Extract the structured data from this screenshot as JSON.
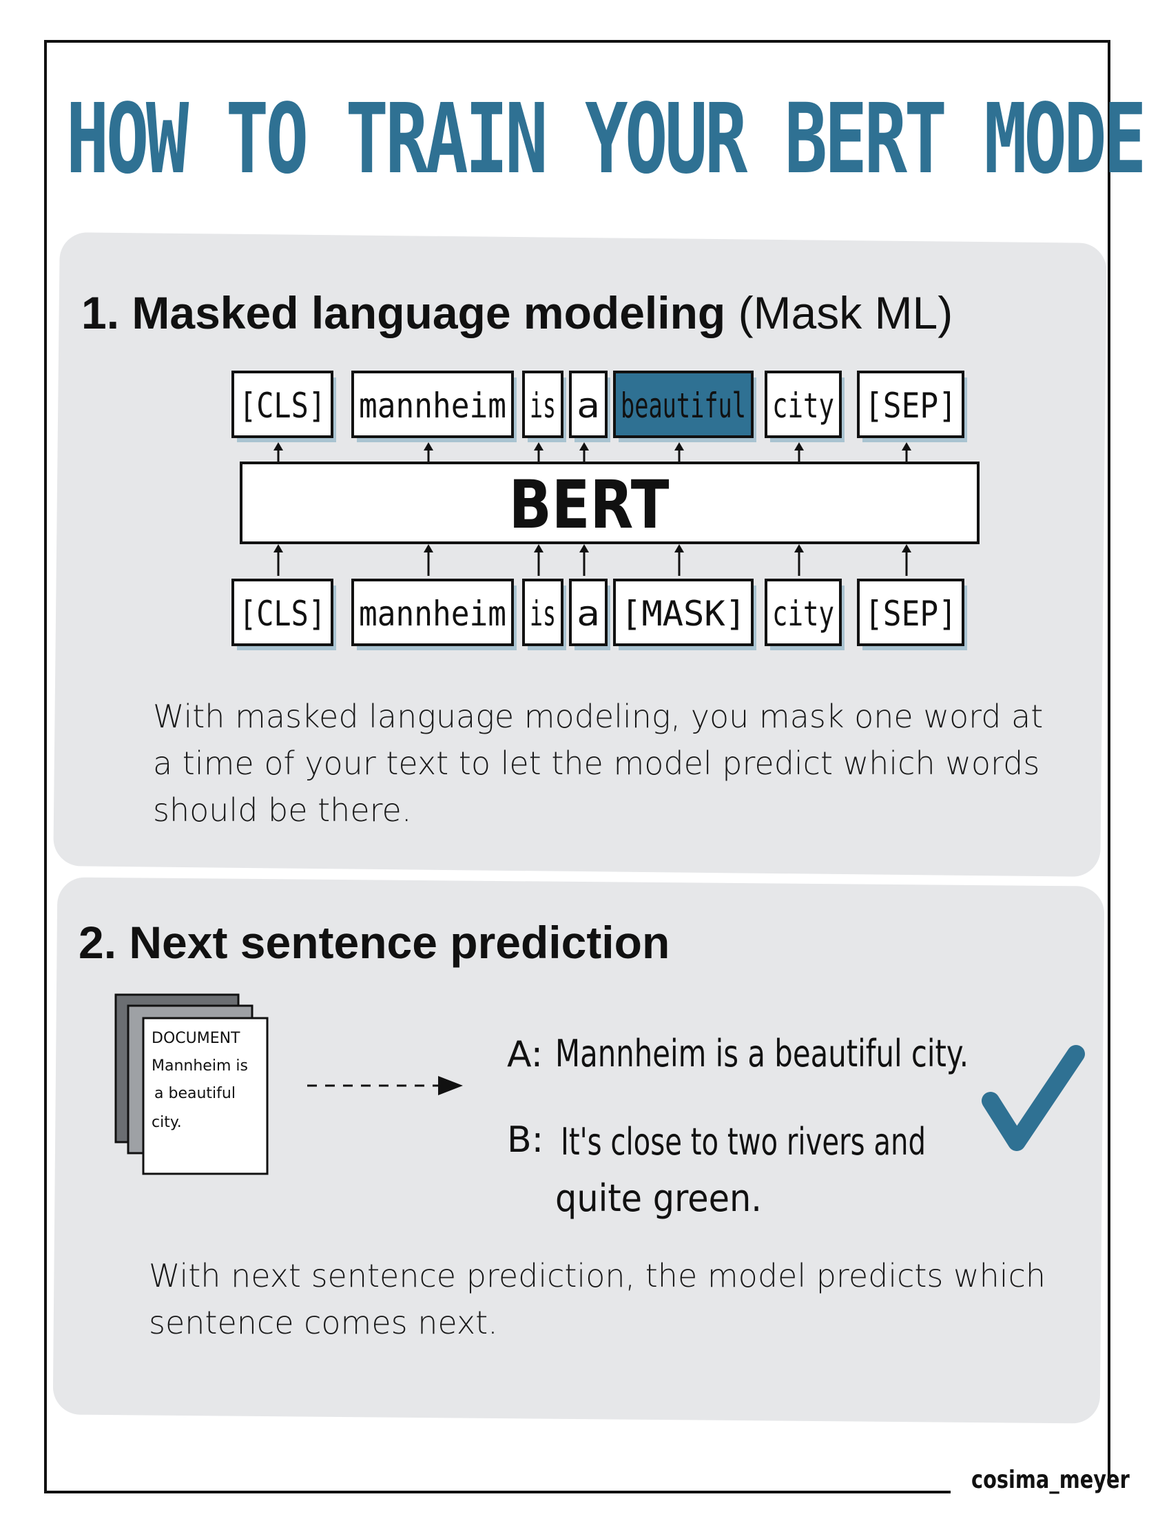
{
  "title": "HOW TO TRAIN YOUR BERT MODEL",
  "section1": {
    "number": "1.",
    "heading_bold": "Masked language modeling",
    "heading_plain": "(Mask ML)",
    "output_tokens": [
      "[CLS]",
      "mannheim",
      "is",
      "a",
      "beautiful",
      "city",
      "[SEP]"
    ],
    "highlighted_token": "beautiful",
    "model_label": "BERT",
    "input_tokens": [
      "[CLS]",
      "mannheim",
      "is",
      "a",
      "[MASK]",
      "city",
      "[SEP]"
    ],
    "description": "With masked language modeling, you mask one word at a time of your text to let the model predict which words should be there."
  },
  "section2": {
    "number": "2.",
    "heading_bold": "Next sentence prediction",
    "document": {
      "label": "DOCUMENT",
      "lines": [
        "Mannheim is",
        "a beautiful",
        "city."
      ]
    },
    "sentence_a_label": "A:",
    "sentence_a": "Mannheim is a beautiful city.",
    "sentence_b_label": "B:",
    "sentence_b_line1": "It's close to two rivers and",
    "sentence_b_line2": "quite green.",
    "description": "With next sentence prediction, the model predicts which sentence comes next."
  },
  "signature": "cosima_meyer",
  "colors": {
    "accent": "#2f7193",
    "panel": "#e6e7e9",
    "ink": "#111111"
  }
}
